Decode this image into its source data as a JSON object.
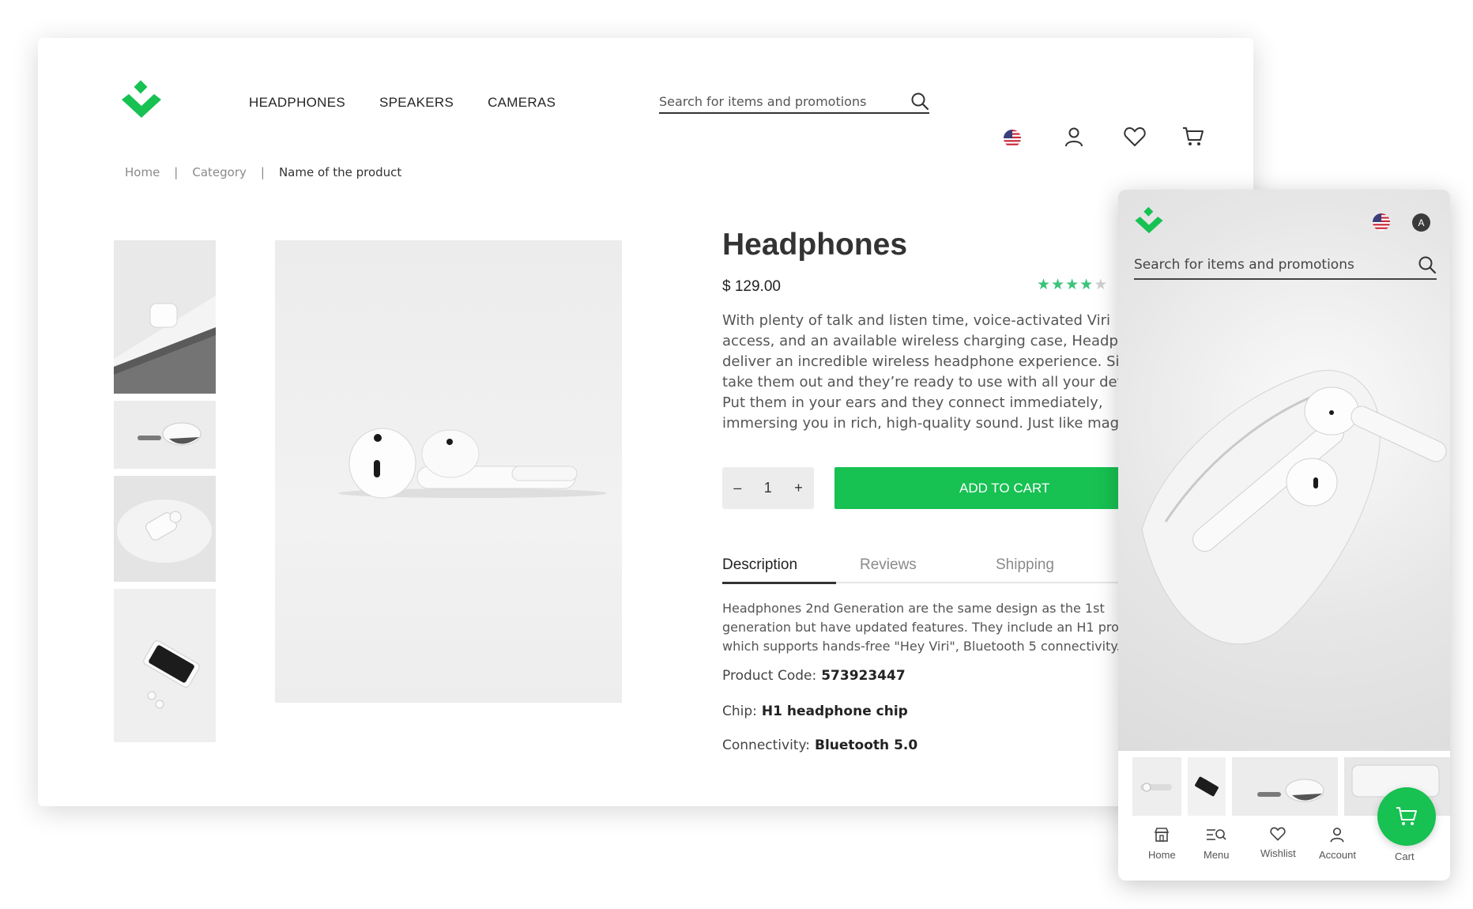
{
  "brand": {
    "accent": "#17c152",
    "star_color": "#3cc37a"
  },
  "nav": {
    "items": [
      "HEADPHONES",
      "SPEAKERS",
      "CAMERAS"
    ]
  },
  "search": {
    "placeholder": "Search for items and promotions"
  },
  "header_icons": [
    "us-flag-icon",
    "user-icon",
    "heart-icon",
    "cart-icon"
  ],
  "breadcrumb": {
    "home": "Home",
    "separator": "|",
    "category": "Category",
    "current": "Name of the product"
  },
  "product": {
    "title": "Headphones",
    "price": "$ 129.00",
    "rating": 4,
    "rating_max": 5,
    "description": "With plenty of talk and listen time, voice-activated Viri access, and an available wireless charging case, Headphones deliver an incredible wireless headphone experience. Simply take them out and they’re ready to use with all your devices. Put them in your ears and they connect immediately, immersing you in rich, high-quality sound. Just like magic.",
    "quantity": "1",
    "qty_minus": "–",
    "qty_plus": "+",
    "add_to_cart": "ADD TO CART"
  },
  "tabs": {
    "description": "Description",
    "reviews": "Reviews",
    "shipping": "Shipping"
  },
  "details": {
    "text": "Headphones 2nd Generation are the same design as the 1st generation but have updated features. They include an H1 processor which supports hands-free \"Hey Viri\", Bluetooth 5 connectivity.",
    "product_code_label": "Product Code:",
    "product_code": "573923447",
    "chip_label": "Chip:",
    "chip": "H1 headphone chip",
    "connectivity_label": "Connectivity:",
    "connectivity": "Bluetooth 5.0"
  },
  "mobile": {
    "search_placeholder": "Search for items and promotions",
    "avatar_initial": "A",
    "nav": {
      "home": "Home",
      "menu": "Menu",
      "wishlist": "Wishlist",
      "account": "Account",
      "cart": "Cart"
    }
  }
}
